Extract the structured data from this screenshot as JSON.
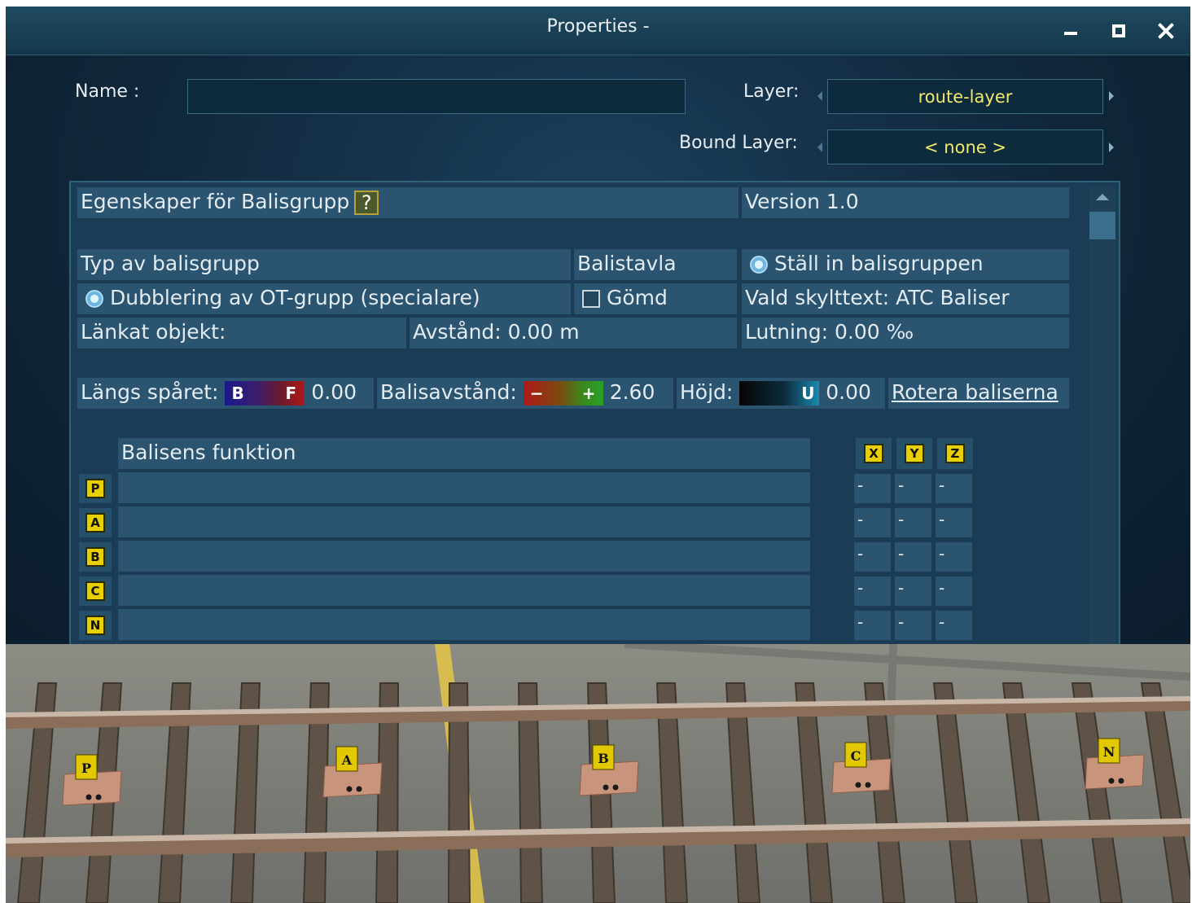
{
  "window": {
    "title": "Properties -",
    "minimize_icon": "minimize-icon",
    "maximize_icon": "maximize-icon",
    "close_icon": "close-icon"
  },
  "header": {
    "name_label": "Name :",
    "name_value": "",
    "layer_label": "Layer:",
    "layer_value": "route-layer",
    "bound_layer_label": "Bound Layer:",
    "bound_layer_value": "< none >"
  },
  "panel": {
    "title": "Egenskaper för Balisgrupp",
    "help": "?",
    "version": "Version 1.0",
    "type_label": "Typ av balisgrupp",
    "board_label": "Balistavla",
    "set_group": "Ställ in balisgruppen",
    "type_value": "Dubblering av OT-grupp (specialare)",
    "hidden_label": "Gömd",
    "sign_text": "Vald skylttext: ATC Baliser",
    "linked_object": "Länkat objekt:",
    "distance": "Avstånd: 0.00 m",
    "gradient": "Lutning: 0.00 ‰",
    "along_track_label": "Längs spåret:",
    "along_track_b": "B",
    "along_track_f": "F",
    "along_track_value": "0.00",
    "spacing_label": "Balisavstånd:",
    "spacing_minus": "−",
    "spacing_plus": "+",
    "spacing_value": "2.60",
    "height_label": "Höjd:",
    "height_u": "U",
    "height_value": "0.00",
    "rotate_link": "Rotera baliserna",
    "function_header": "Balisens funktion",
    "axes": [
      "X",
      "Y",
      "Z"
    ],
    "rows": [
      {
        "letter": "P",
        "function": "",
        "x": "-",
        "y": "-",
        "z": "-"
      },
      {
        "letter": "A",
        "function": "",
        "x": "-",
        "y": "-",
        "z": "-"
      },
      {
        "letter": "B",
        "function": "",
        "x": "-",
        "y": "-",
        "z": "-"
      },
      {
        "letter": "C",
        "function": "",
        "x": "-",
        "y": "-",
        "z": "-"
      },
      {
        "letter": "N",
        "function": "",
        "x": "-",
        "y": "-",
        "z": "-"
      }
    ]
  },
  "scene": {
    "balises": [
      "P",
      "A",
      "B",
      "C",
      "N"
    ]
  }
}
